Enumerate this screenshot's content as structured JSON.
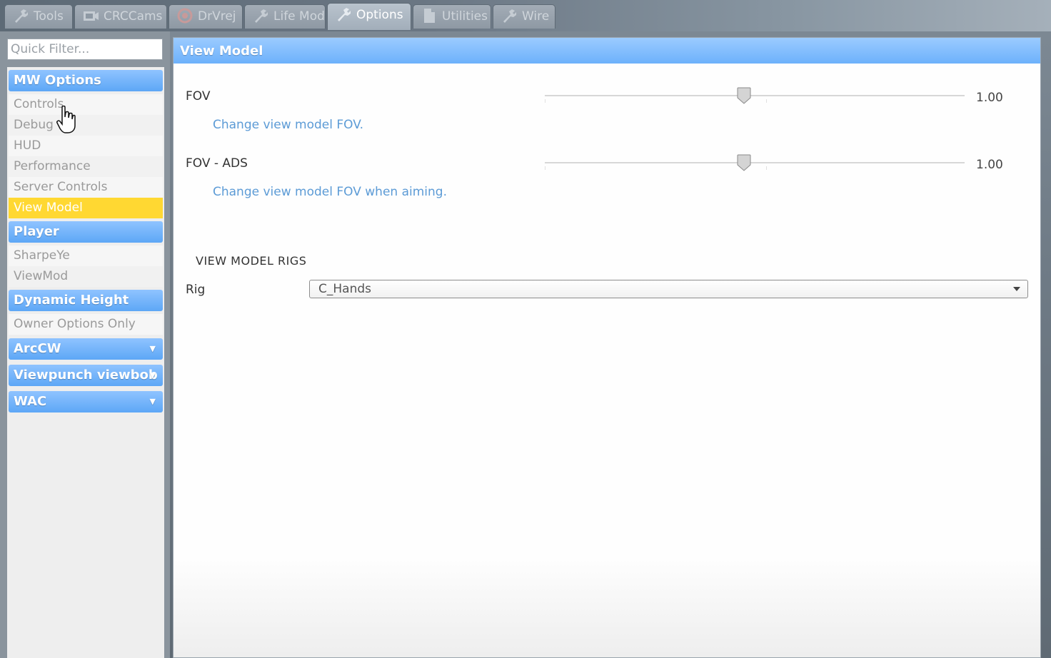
{
  "tabs": [
    {
      "label": "Tools",
      "icon": "wrench-icon"
    },
    {
      "label": "CRCCams",
      "icon": "camera-icon"
    },
    {
      "label": "DrVrej",
      "icon": "gear-icon"
    },
    {
      "label": "Life Mod",
      "icon": "wrench-icon"
    },
    {
      "label": "Options",
      "icon": "wrench-icon",
      "active": true
    },
    {
      "label": "Utilities",
      "icon": "document-icon"
    },
    {
      "label": "Wire",
      "icon": "wrench-icon"
    }
  ],
  "sidebar": {
    "filter_placeholder": "Quick Filter...",
    "categories": [
      {
        "title": "MW Options",
        "items": [
          "Controls",
          "Debug",
          "HUD",
          "Performance",
          "Server Controls",
          "View Model"
        ],
        "selected": "View Model"
      },
      {
        "title": "Player",
        "items": [
          "SharpeYe",
          "ViewMod"
        ]
      },
      {
        "title": "Dynamic Height",
        "items": [
          "Owner Options Only"
        ]
      },
      {
        "title": "ArcCW",
        "items": [],
        "collapsed": true
      },
      {
        "title": "Viewpunch viewbob",
        "items": [],
        "collapsed": true
      },
      {
        "title": "WAC",
        "items": [],
        "collapsed": true
      }
    ]
  },
  "panel": {
    "title": "View Model",
    "settings": [
      {
        "label": "FOV",
        "value": "1.00",
        "help": "Change view model FOV."
      },
      {
        "label": "FOV - ADS",
        "value": "1.00",
        "help": "Change view model FOV when aiming."
      }
    ],
    "section_title": "VIEW MODEL RIGS",
    "rig_label": "Rig",
    "rig_value": "C_Hands"
  },
  "colors": {
    "accent_blue": "#6db1fb",
    "selected_yellow": "#ffd832",
    "help_text": "#5c9bd6"
  }
}
